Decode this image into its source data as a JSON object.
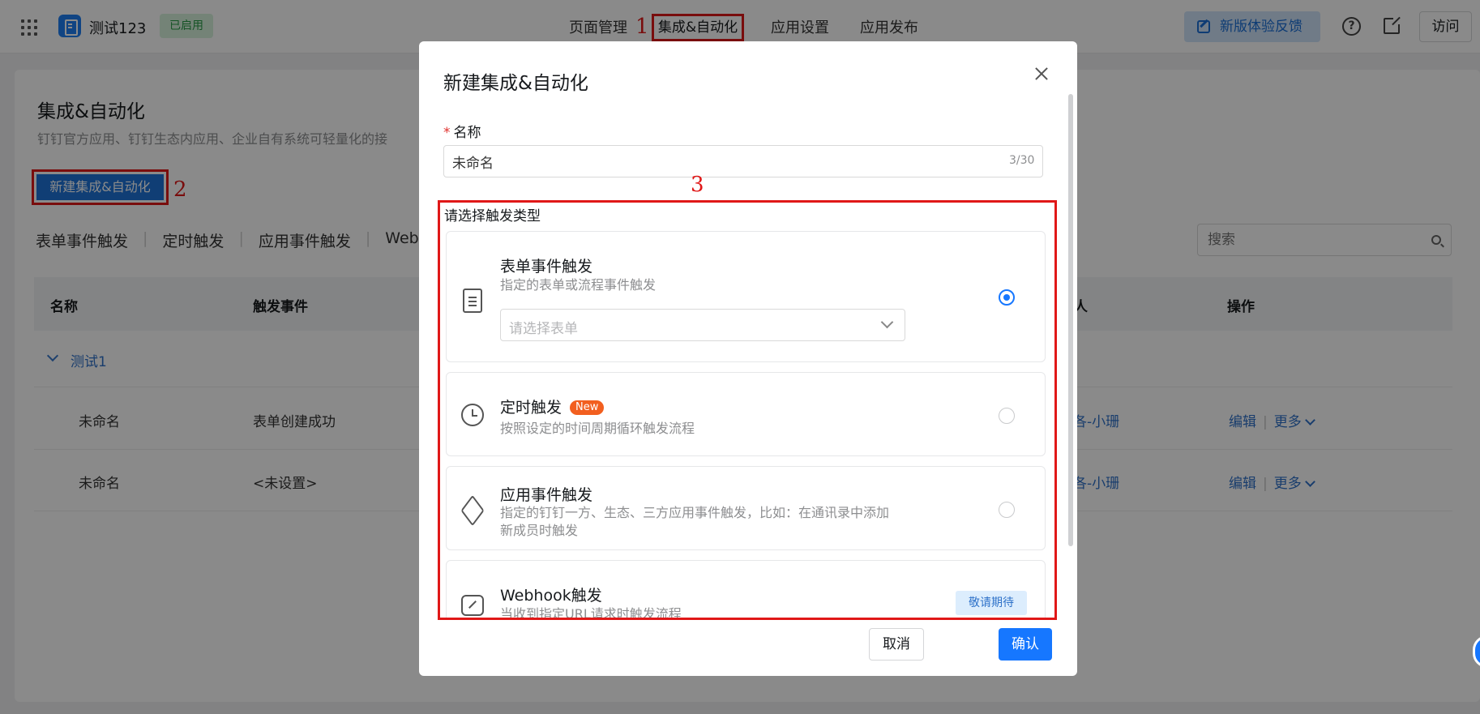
{
  "topbar": {
    "app_name": "测试123",
    "status": "已启用",
    "nav": [
      "页面管理",
      "集成&自动化",
      "应用设置",
      "应用发布"
    ],
    "feedback": "新版体验反馈",
    "visit": "访问",
    "icons": [
      "apps-grid-icon",
      "app-logo",
      "help-icon",
      "external-link-icon"
    ]
  },
  "annotations": [
    "1",
    "2",
    "3"
  ],
  "page": {
    "title": "集成&自动化",
    "description": "钉钉官方应用、钉钉生态内应用、企业自有系统可轻量化的接",
    "new_button": "新建集成&自动化",
    "tabs": [
      "表单事件触发",
      "定时触发",
      "应用事件触发",
      "Web"
    ],
    "search_placeholder": "搜索",
    "columns": [
      "名称",
      "触发事件",
      "人",
      "操作"
    ],
    "group": "测试1",
    "rows": [
      {
        "name": "未命名",
        "event": "表单创建成功",
        "person": "各-小珊",
        "edit": "编辑",
        "more": "更多"
      },
      {
        "name": "未命名",
        "event": "<未设置>",
        "person": "各-小珊",
        "edit": "编辑",
        "more": "更多"
      }
    ]
  },
  "modal": {
    "title": "新建集成&自动化",
    "name_label": "名称",
    "name_value": "未命名",
    "counter": "3/30",
    "trigger_label": "请选择触发类型",
    "triggers": [
      {
        "title": "表单事件触发",
        "desc": "指定的表单或流程事件触发",
        "select_placeholder": "请选择表单",
        "selected": true,
        "icon": "document-icon"
      },
      {
        "title": "定时触发",
        "badge": "New",
        "desc": "按照设定的时间周期循环触发流程",
        "selected": false,
        "icon": "alarm-clock-icon"
      },
      {
        "title": "应用事件触发",
        "desc": "指定的钉钉一方、生态、三方应用事件触发，比如：在通讯录中添加新成员时触发",
        "selected": false,
        "icon": "cube-icon"
      },
      {
        "title": "Webhook触发",
        "desc": "当收到指定URL请求时触发流程",
        "soon": "敬请期待",
        "icon": "link-icon"
      }
    ],
    "cancel": "取消",
    "confirm": "确认"
  }
}
